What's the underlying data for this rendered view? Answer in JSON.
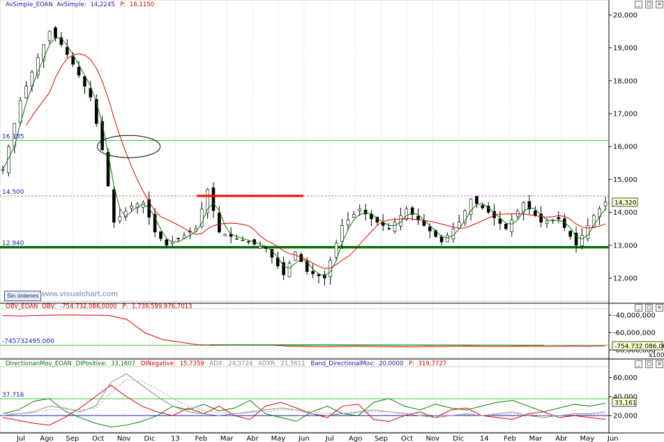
{
  "chart_data": [
    {
      "type": "candlestick",
      "header": {
        "series_name": "AvSimple_EOAN",
        "indicator": "AvSimple:",
        "indicator_value": "14,2245",
        "p_label": "P:",
        "p_value": "16,1150"
      },
      "y_ticks": [
        "20,000",
        "19,000",
        "18,000",
        "17,000",
        "16,000",
        "15,000",
        "14,000",
        "13,000",
        "12,000"
      ],
      "ylim": [
        11.3,
        20.2
      ],
      "last_price_label": "14,320",
      "levels": [
        {
          "label": "16.185",
          "value": 16.185,
          "color": "#33cc33"
        },
        {
          "label": "14.500",
          "value": 14.5,
          "color": "#e04040"
        },
        {
          "label": "12.940",
          "value": 12.94,
          "color": "#007000"
        }
      ],
      "resistance_segment": {
        "from_month": "Feb",
        "to_month": "Jun",
        "value": 14.5,
        "color": "#ff0000"
      },
      "key_points": {
        "x_index": [
          0,
          3,
          6,
          8,
          10,
          12,
          15,
          17,
          19,
          22,
          24,
          26,
          28,
          30,
          33,
          35,
          37,
          40,
          42,
          45,
          48,
          50,
          52,
          55,
          58,
          61,
          63,
          66,
          69,
          72,
          75,
          78,
          80,
          83,
          86,
          89,
          92,
          95,
          98,
          101,
          103
        ],
        "close": [
          15.3,
          17.4,
          18.7,
          19.5,
          19.1,
          18.5,
          17.5,
          15.9,
          13.7,
          14.2,
          14.3,
          13.4,
          13.0,
          13.2,
          13.5,
          14.7,
          13.4,
          13.2,
          13.1,
          12.9,
          12.1,
          12.8,
          12.2,
          12.0,
          13.6,
          14.1,
          13.8,
          13.5,
          14.1,
          13.6,
          13.1,
          13.7,
          14.4,
          14.0,
          13.5,
          14.3,
          13.7,
          13.8,
          13.0,
          13.9,
          14.32
        ]
      },
      "moving_average_fast": {
        "color": "#008000"
      },
      "moving_average_slow": {
        "color": "#e00000"
      },
      "ellipse_annotation": {
        "month": "Nov",
        "value": 16.0
      }
    },
    {
      "type": "line",
      "header": {
        "series_name": "OBV_EOAN",
        "indicator": "OBV:",
        "indicator_value": "-754.732.086,0000",
        "p_label": "P:",
        "p_value": "1.739.599.976,7013"
      },
      "y_ticks": [
        "-40,000,000",
        "-60,000,000",
        "-80,000,000"
      ],
      "level_label": "-745732495.000",
      "last_value_label": "-754.732.086,000",
      "scale_note": "x10000",
      "series": [
        {
          "color": "#e00000",
          "values": [
            -40.5,
            -41.0,
            -40.2,
            -40.0,
            -39.8,
            -40.1,
            -40.4,
            -45.0,
            -60.0,
            -68.0,
            -71.0,
            -74.0,
            -74.5,
            -74.0,
            -74.2,
            -74.0,
            -75.5,
            -76.0,
            -76.3,
            -76.0,
            -75.8,
            -76.0,
            -76.2,
            -76.5,
            -75.9,
            -76.0,
            -75.5,
            -75.8,
            -76.1,
            -75.7,
            -75.8,
            -75.9,
            -75.4,
            -75.6,
            -75.2
          ]
        },
        {
          "color": "#008000",
          "values": [
            -74.0,
            -74.1,
            -74.3,
            -74.6
          ]
        }
      ]
    },
    {
      "type": "line",
      "header": {
        "series_name": "DirectionanMov_EOAN",
        "dip_label": "DIPositive:",
        "dip_value": "33,1607",
        "din_label": "DINegative:",
        "din_value": "15,7359",
        "adx_label": "ADX:",
        "adx_value": "24,3724",
        "adxr_label": "ADXR:",
        "adxr_value": "21,5611",
        "band_label": "Band_DirectionalMov:",
        "band_value": "20,0000",
        "p_label": "P:",
        "p_value": "319,7727"
      },
      "y_ticks": [
        "60,000",
        "40,000",
        "20,000"
      ],
      "ylim": [
        4,
        70
      ],
      "level_label": "37.716",
      "last_value_label": "33,161",
      "series": [
        {
          "color": "#008000",
          "values": [
            22,
            26,
            35,
            38,
            25,
            18,
            12,
            8,
            10,
            14,
            20,
            30,
            26,
            32,
            25,
            28,
            36,
            22,
            18,
            14,
            24,
            30,
            22,
            20,
            34,
            38,
            30,
            26,
            32,
            28,
            26,
            30,
            34,
            36,
            30,
            24,
            28,
            32,
            30,
            33
          ]
        },
        {
          "color": "#e00000",
          "values": [
            18,
            15,
            12,
            10,
            18,
            28,
            40,
            52,
            40,
            30,
            24,
            20,
            28,
            22,
            30,
            20,
            16,
            30,
            34,
            28,
            22,
            18,
            30,
            32,
            16,
            14,
            20,
            24,
            18,
            26,
            28,
            20,
            18,
            16,
            22,
            24,
            18,
            20,
            18,
            16
          ]
        },
        {
          "color": "#8c8c8c",
          "values": [
            20,
            22,
            24,
            30,
            28,
            24,
            30,
            55,
            64,
            52,
            40,
            30,
            24,
            22,
            20,
            22,
            24,
            26,
            28,
            26,
            22,
            20,
            22,
            24,
            26,
            24,
            22,
            20,
            18,
            20,
            22,
            20,
            22,
            24,
            20,
            18,
            20,
            22,
            22,
            24
          ]
        },
        {
          "color": "#b0b0b0",
          "values": [
            22,
            22,
            23,
            26,
            27,
            26,
            28,
            44,
            58,
            56,
            48,
            38,
            30,
            26,
            23,
            22,
            23,
            24,
            26,
            26,
            24,
            22,
            22,
            23,
            24,
            24,
            23,
            22,
            20,
            20,
            21,
            20,
            21,
            22,
            21,
            20,
            20,
            21,
            21,
            22
          ]
        }
      ],
      "band_value": 20,
      "level_value": 37.716
    }
  ],
  "x_axis": {
    "months": [
      "Jul",
      "Ago",
      "Sep",
      "Oct",
      "Nov",
      "Dic",
      "13",
      "Feb",
      "Mar",
      "Abr",
      "May",
      "Jun",
      "Jul",
      "Ago",
      "Sep",
      "Oct",
      "Nov",
      "Dic",
      "14",
      "Feb",
      "Mar",
      "Abr",
      "May",
      "Jun"
    ]
  },
  "ui": {
    "status_button": "Sin órdenes",
    "watermark": "www.visualchart.com",
    "window_buttons": [
      "_",
      "□",
      "×"
    ]
  }
}
